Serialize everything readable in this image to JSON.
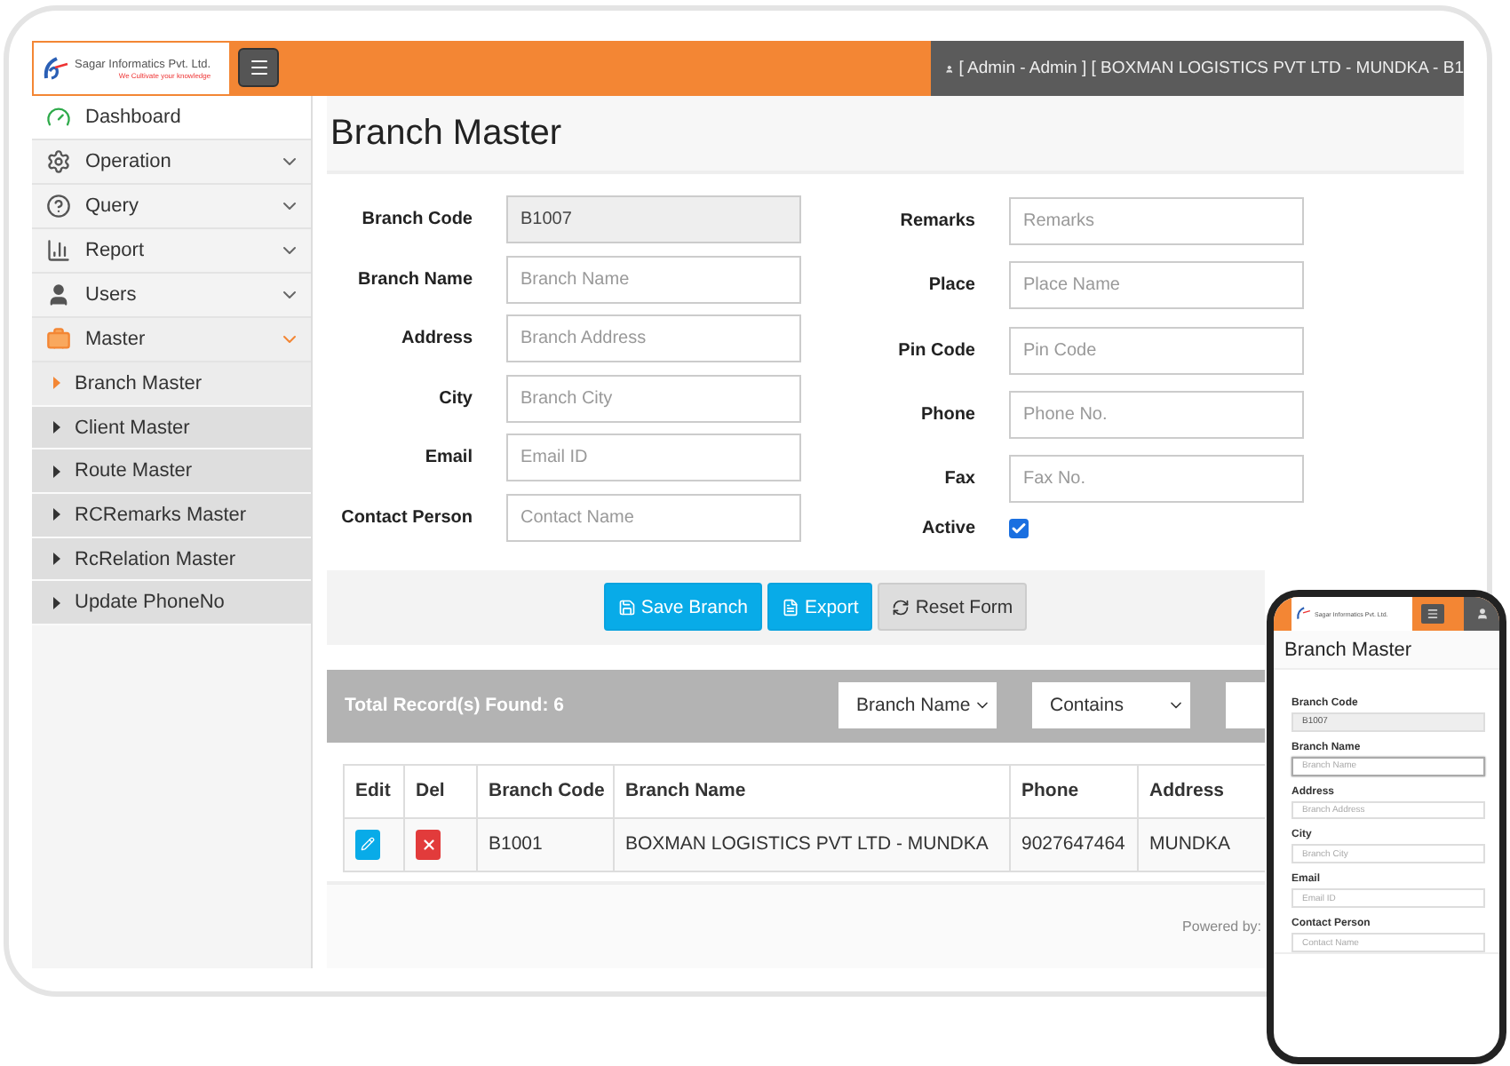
{
  "brand": {
    "name": "Sagar Informatics Pvt. Ltd.",
    "tagline": "We Cultivate your knowledge"
  },
  "header": {
    "user_info": "[ Admin - Admin ] [ BOXMAN LOGISTICS PVT LTD - MUNDKA - B1"
  },
  "sidebar": {
    "items": [
      {
        "label": "Dashboard",
        "kind": "link"
      },
      {
        "label": "Operation",
        "kind": "menu",
        "expanded": false
      },
      {
        "label": "Query",
        "kind": "menu",
        "expanded": false
      },
      {
        "label": "Report",
        "kind": "menu",
        "expanded": false
      },
      {
        "label": "Users",
        "kind": "menu",
        "expanded": false
      },
      {
        "label": "Master",
        "kind": "menu",
        "expanded": true,
        "children": [
          {
            "label": "Branch Master",
            "selected": true
          },
          {
            "label": "Client Master",
            "selected": false
          },
          {
            "label": "Route Master",
            "selected": false
          },
          {
            "label": "RCRemarks Master",
            "selected": false
          },
          {
            "label": "RcRelation Master",
            "selected": false
          },
          {
            "label": "Update PhoneNo",
            "selected": false
          }
        ]
      }
    ]
  },
  "page": {
    "title": "Branch Master"
  },
  "form": {
    "left": [
      {
        "label": "Branch Code",
        "kind": "text",
        "value": "B1007",
        "disabled": true
      },
      {
        "label": "Branch Name",
        "kind": "text",
        "placeholder": "Branch Name",
        "disabled": false
      },
      {
        "label": "Address",
        "kind": "text",
        "placeholder": "Branch Address",
        "disabled": false
      },
      {
        "label": "City",
        "kind": "text",
        "placeholder": "Branch City",
        "disabled": false
      },
      {
        "label": "Email",
        "kind": "text",
        "placeholder": "Email ID",
        "disabled": false
      },
      {
        "label": "Contact Person",
        "kind": "text",
        "placeholder": "Contact Name",
        "disabled": false
      }
    ],
    "right": [
      {
        "label": "Remarks",
        "kind": "text",
        "placeholder": "Remarks",
        "disabled": false
      },
      {
        "label": "Place",
        "kind": "text",
        "placeholder": "Place Name",
        "disabled": false
      },
      {
        "label": "Pin Code",
        "kind": "text",
        "placeholder": "Pin Code",
        "disabled": false
      },
      {
        "label": "Phone",
        "kind": "text",
        "placeholder": "Phone No.",
        "disabled": false
      },
      {
        "label": "Fax",
        "kind": "text",
        "placeholder": "Fax No.",
        "disabled": false
      },
      {
        "label": "Active",
        "kind": "checkbox",
        "checked": true
      }
    ]
  },
  "buttons": [
    {
      "label": "Save Branch",
      "kind": "primary"
    },
    {
      "label": "Export",
      "kind": "primary"
    },
    {
      "label": "Reset Form",
      "kind": "default"
    }
  ],
  "records": {
    "total": "Total Record(s) Found: 6",
    "filters": [
      {
        "kind": "select",
        "value": "Branch Name"
      },
      {
        "kind": "select",
        "value": "Contains"
      },
      {
        "kind": "input"
      }
    ]
  },
  "table": {
    "columns": [
      "Edit",
      "Del",
      "Branch Code",
      "Branch Name",
      "Phone",
      "Address"
    ],
    "rows": [
      {
        "branch_code": "B1001",
        "branch_name": "BOXMAN LOGISTICS PVT LTD - MUNDKA",
        "phone": "9027647464",
        "address": "MUNDKA"
      }
    ]
  },
  "footer": {
    "text": "Powered by:"
  },
  "phone": {
    "brand_name": "Sagar Informatics Pvt. Ltd.",
    "title": "Branch Master",
    "fields": [
      {
        "label": "Branch Code",
        "value": "B1007",
        "disabled": true,
        "focused": false
      },
      {
        "label": "Branch Name",
        "placeholder": "Branch Name",
        "disabled": false,
        "focused": true
      },
      {
        "label": "Address",
        "placeholder": "Branch Address",
        "disabled": false,
        "focused": false
      },
      {
        "label": "City",
        "placeholder": "Branch City",
        "disabled": false,
        "focused": false
      },
      {
        "label": "Email",
        "placeholder": "Email ID",
        "disabled": false,
        "focused": false
      },
      {
        "label": "Contact Person",
        "placeholder": "Contact Name",
        "disabled": false,
        "focused": false
      }
    ]
  }
}
